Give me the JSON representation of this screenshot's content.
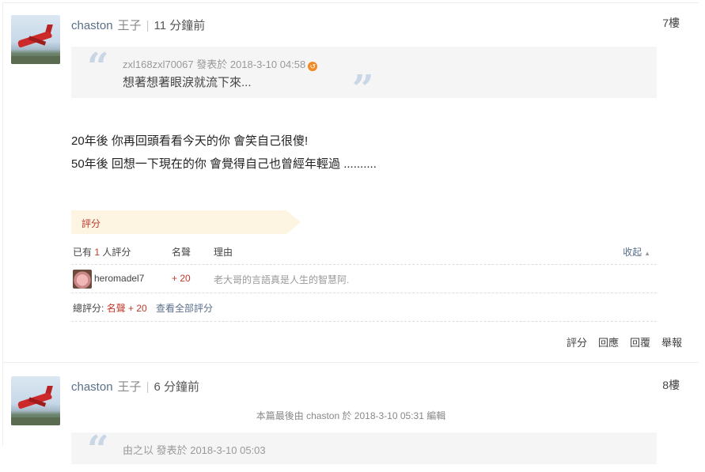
{
  "posts": [
    {
      "author": "chaston",
      "title": "王子",
      "time": "11 分鐘前",
      "floor": "7樓",
      "quote": {
        "meta": "zxl168zxl70067 發表於 2018-3-10 04:58",
        "text": "想著想著眼淚就流下來..."
      },
      "body": [
        "20年後 你再回頭看看今天的你 會笑自己很傻!",
        "50年後 回想一下現在的你 會覺得自己也曾經年輕過 .........."
      ],
      "rating": {
        "tab": "評分",
        "header_prefix": "已有",
        "count": "1",
        "header_suffix": "人評分",
        "col_reputation": "名聲",
        "col_reason": "理由",
        "collapse": "收起",
        "entries": [
          {
            "user": "heromadel7",
            "score": "+ 20",
            "reason": "老大哥的言語真是人生的智慧阿."
          }
        ],
        "summary_label": "總評分:",
        "summary_value": "名聲 + 20",
        "view_all": "查看全部評分"
      },
      "actions": [
        "評分",
        "回應",
        "回覆",
        "舉報"
      ]
    },
    {
      "author": "chaston",
      "title": "王子",
      "time": "6 分鐘前",
      "floor": "8樓",
      "edited": "本篇最後由 chaston 於 2018-3-10 05:31 編輯",
      "quote": {
        "meta": "由之以 發表於 2018-3-10 05:03"
      }
    }
  ],
  "colors": {
    "accent_red": "#c0392b",
    "link_blue": "#5a6e8a",
    "rating_tab_bg": "#fdf4e2",
    "quote_bg": "#f5f5f5"
  },
  "icons": [
    "back-arrow-icon",
    "caret-up-icon"
  ]
}
